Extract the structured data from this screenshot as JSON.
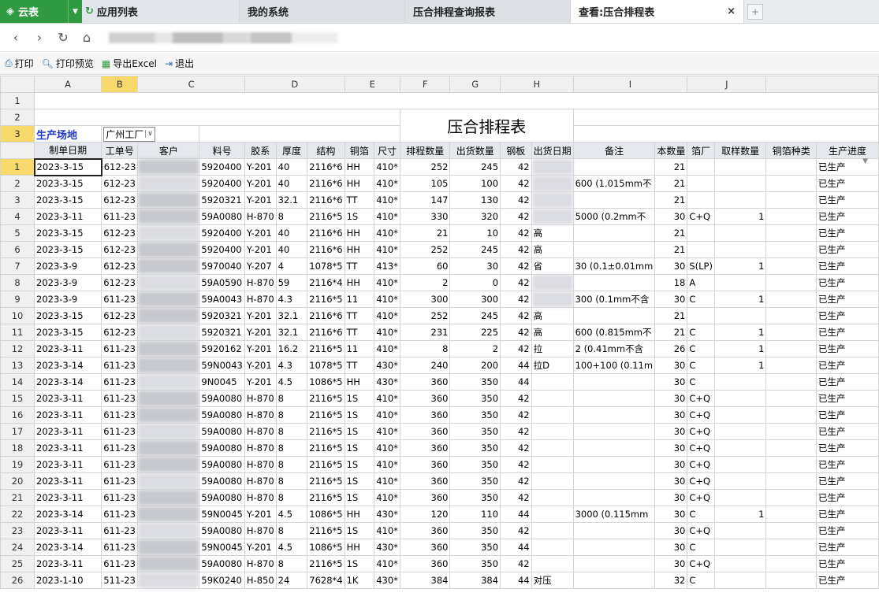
{
  "tabs": {
    "app": "云表",
    "list": [
      {
        "label": "应用列表"
      },
      {
        "label": "我的系统"
      },
      {
        "label": "压合排程查询报表"
      },
      {
        "label": "查看:压合排程表"
      }
    ],
    "close": "×",
    "new_tab": "+"
  },
  "toolbar": {
    "print": "打印",
    "preview": "打印预览",
    "export": "导出Excel",
    "exit": "退出"
  },
  "columns": [
    "A",
    "B",
    "C",
    "D",
    "E",
    "F",
    "G",
    "H",
    "I",
    "J"
  ],
  "sheet": {
    "title": "压合排程表",
    "site_label": "生产场地",
    "site_value": "广州工厂"
  },
  "headers": [
    "制单日期",
    "工单号",
    "客户",
    "料号",
    "胶系",
    "厚度",
    "结构",
    "铜箔",
    "尺寸",
    "排程数量",
    "出货数量",
    "钢板",
    "出货日期",
    "备注",
    "本数量",
    "箔厂",
    "取样数量",
    "铜箔种类",
    "生产进度"
  ],
  "rows": [
    [
      "2023-3-15",
      "612-23",
      "",
      "5920400",
      "Y-201",
      "40",
      "2116*6",
      "HH",
      "410*",
      "252",
      "245",
      "42",
      "",
      "",
      "21",
      "",
      "",
      "",
      "已生产"
    ],
    [
      "2023-3-15",
      "612-23",
      "",
      "5920400",
      "Y-201",
      "40",
      "2116*6",
      "HH",
      "410*",
      "105",
      "100",
      "42",
      "",
      "600 (1.015mm不",
      "21",
      "",
      "",
      "",
      "已生产"
    ],
    [
      "2023-3-15",
      "612-23",
      "",
      "5920321",
      "Y-201",
      "32.1",
      "2116*6",
      "TT",
      "410*",
      "147",
      "130",
      "42",
      "",
      "",
      "21",
      "",
      "",
      "",
      "已生产"
    ],
    [
      "2023-3-11",
      "611-23",
      "",
      "59A0080",
      "H-870",
      "8",
      "2116*5",
      "1S",
      "410*",
      "330",
      "320",
      "42",
      "",
      "5000 (0.2mm不",
      "30",
      "C+Q",
      "1",
      "",
      "已生产"
    ],
    [
      "2023-3-15",
      "612-23",
      "",
      "5920400",
      "Y-201",
      "40",
      "2116*6",
      "HH",
      "410*",
      "21",
      "10",
      "42",
      "高",
      "",
      "21",
      "",
      "",
      "",
      "已生产"
    ],
    [
      "2023-3-15",
      "612-23",
      "",
      "5920400",
      "Y-201",
      "40",
      "2116*6",
      "HH",
      "410*",
      "252",
      "245",
      "42",
      "高",
      "",
      "21",
      "",
      "",
      "",
      "已生产"
    ],
    [
      "2023-3-9",
      "612-23",
      "",
      "5970040",
      "Y-207",
      "4",
      "1078*5",
      "TT",
      "413*",
      "60",
      "30",
      "42",
      "省",
      "30 (0.1±0.01mm",
      "30",
      "S(LP)",
      "1",
      "",
      "已生产"
    ],
    [
      "2023-3-9",
      "612-23",
      "",
      "59A0590",
      "H-870",
      "59",
      "2116*4",
      "HH",
      "410*",
      "2",
      "0",
      "42",
      "",
      "",
      "18",
      "A",
      "",
      "",
      "已生产"
    ],
    [
      "2023-3-9",
      "611-23",
      "",
      "59A0043",
      "H-870",
      "4.3",
      "2116*5",
      "11",
      "410*",
      "300",
      "300",
      "42",
      "",
      "300 (0.1mm不含",
      "30",
      "C",
      "1",
      "",
      "已生产"
    ],
    [
      "2023-3-15",
      "612-23",
      "",
      "5920321",
      "Y-201",
      "32.1",
      "2116*6",
      "TT",
      "410*",
      "252",
      "245",
      "42",
      "高",
      "",
      "21",
      "",
      "",
      "",
      "已生产"
    ],
    [
      "2023-3-15",
      "612-23",
      "",
      "5920321",
      "Y-201",
      "32.1",
      "2116*6",
      "TT",
      "410*",
      "231",
      "225",
      "42",
      "高",
      "600 (0.815mm不",
      "21",
      "C",
      "1",
      "",
      "已生产"
    ],
    [
      "2023-3-11",
      "611-23",
      "",
      "5920162",
      "Y-201",
      "16.2",
      "2116*5",
      "11",
      "410*",
      "8",
      "2",
      "42",
      "拉",
      "2 (0.41mm不含",
      "26",
      "C",
      "1",
      "",
      "已生产"
    ],
    [
      "2023-3-14",
      "611-23",
      "",
      "59N0043",
      "Y-201",
      "4.3",
      "1078*5",
      "TT",
      "430*",
      "240",
      "200",
      "44",
      "拉D",
      "100+100 (0.11m",
      "30",
      "C",
      "1",
      "",
      "已生产"
    ],
    [
      "2023-3-14",
      "611-23",
      "",
      "9N0045",
      "Y-201",
      "4.5",
      "1086*5",
      "HH",
      "430*",
      "360",
      "350",
      "44",
      "",
      "",
      "30",
      "C",
      "",
      "",
      "已生产"
    ],
    [
      "2023-3-11",
      "611-23",
      "",
      "59A0080",
      "H-870",
      "8",
      "2116*5",
      "1S",
      "410*",
      "360",
      "350",
      "42",
      "",
      "",
      "30",
      "C+Q",
      "",
      "",
      "已生产"
    ],
    [
      "2023-3-11",
      "611-23",
      "",
      "59A0080",
      "H-870",
      "8",
      "2116*5",
      "1S",
      "410*",
      "360",
      "350",
      "42",
      "",
      "",
      "30",
      "C+Q",
      "",
      "",
      "已生产"
    ],
    [
      "2023-3-11",
      "611-23",
      "",
      "59A0080",
      "H-870",
      "8",
      "2116*5",
      "1S",
      "410*",
      "360",
      "350",
      "42",
      "",
      "",
      "30",
      "C+Q",
      "",
      "",
      "已生产"
    ],
    [
      "2023-3-11",
      "611-23",
      "",
      "59A0080",
      "H-870",
      "8",
      "2116*5",
      "1S",
      "410*",
      "360",
      "350",
      "42",
      "",
      "",
      "30",
      "C+Q",
      "",
      "",
      "已生产"
    ],
    [
      "2023-3-11",
      "611-23",
      "",
      "59A0080",
      "H-870",
      "8",
      "2116*5",
      "1S",
      "410*",
      "360",
      "350",
      "42",
      "",
      "",
      "30",
      "C+Q",
      "",
      "",
      "已生产"
    ],
    [
      "2023-3-11",
      "611-23",
      "",
      "59A0080",
      "H-870",
      "8",
      "2116*5",
      "1S",
      "410*",
      "360",
      "350",
      "42",
      "",
      "",
      "30",
      "C+Q",
      "",
      "",
      "已生产"
    ],
    [
      "2023-3-11",
      "611-23",
      "",
      "59A0080",
      "H-870",
      "8",
      "2116*5",
      "1S",
      "410*",
      "360",
      "350",
      "42",
      "",
      "",
      "30",
      "C+Q",
      "",
      "",
      "已生产"
    ],
    [
      "2023-3-14",
      "611-23",
      "",
      "59N0045",
      "Y-201",
      "4.5",
      "1086*5",
      "HH",
      "430*",
      "120",
      "110",
      "44",
      "",
      "3000 (0.115mm",
      "30",
      "C",
      "1",
      "",
      "已生产"
    ],
    [
      "2023-3-11",
      "611-23",
      "",
      "59A0080",
      "H-870",
      "8",
      "2116*5",
      "1S",
      "410*",
      "360",
      "350",
      "42",
      "",
      "",
      "30",
      "C+Q",
      "",
      "",
      "已生产"
    ],
    [
      "2023-3-14",
      "611-23",
      "",
      "59N0045",
      "Y-201",
      "4.5",
      "1086*5",
      "HH",
      "430*",
      "360",
      "350",
      "44",
      "",
      "",
      "30",
      "C",
      "",
      "",
      "已生产"
    ],
    [
      "2023-3-11",
      "611-23",
      "",
      "59A0080",
      "H-870",
      "8",
      "2116*5",
      "1S",
      "410*",
      "360",
      "350",
      "42",
      "",
      "",
      "30",
      "C+Q",
      "",
      "",
      "已生产"
    ],
    [
      "2023-1-10",
      "511-23",
      "",
      "59K0240",
      "H-850",
      "24",
      "7628*4",
      "1K",
      "430*",
      "384",
      "384",
      "44",
      "对压",
      "",
      "32",
      "C",
      "",
      "",
      "已生产"
    ]
  ]
}
